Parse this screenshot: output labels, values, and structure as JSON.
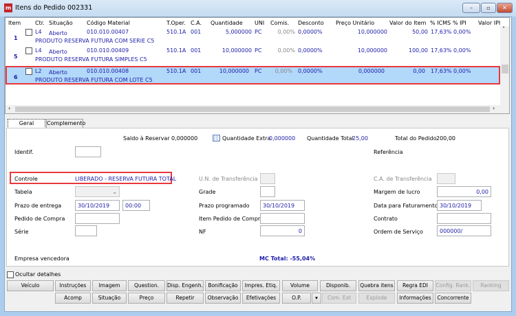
{
  "window": {
    "title": "Itens do Pedido 002331",
    "logo_text": "m",
    "min": "–",
    "max": "▫",
    "close": "✕"
  },
  "grid": {
    "columns": [
      "Item",
      "Ctr.",
      "Situação",
      "Código Material",
      "T.Oper.",
      "C.A.",
      "Quantidade",
      "UNI",
      "Comis.",
      "Desconto",
      "Preço Unitário",
      "Valor do Item",
      "% ICMS",
      "% IPI",
      "Valor IPI"
    ],
    "rows": [
      {
        "item": "1",
        "ctr": "L4",
        "situacao": "Aberto",
        "codigo": "010.010.00407",
        "toper": "510.1A",
        "ca": "001",
        "quantidade": "5,000000",
        "uni": "PC",
        "comis": "0,00%",
        "desconto": "0,0000%",
        "preco": "10,000000",
        "valor": "50,00",
        "icms": "17,63%",
        "ipi": "0,00%",
        "valor_ipi": "",
        "descricao": "PRODUTO RESERVA FUTURA COM SERIE C5",
        "selected": false
      },
      {
        "item": "5",
        "ctr": "L4",
        "situacao": "Aberto",
        "codigo": "010.010.00409",
        "toper": "510.1A",
        "ca": "001",
        "quantidade": "10,000000",
        "uni": "PC",
        "comis": "0,00%",
        "desconto": "0,0000%",
        "preco": "10,000000",
        "valor": "100,00",
        "icms": "17,63%",
        "ipi": "0,00%",
        "valor_ipi": "",
        "descricao": "PRODUTO RESERVA FUTURA SIMPLES C5",
        "selected": false
      },
      {
        "item": "6",
        "ctr": "L2",
        "situacao": "Aberto",
        "codigo": "010.010.00408",
        "toper": "510.1A",
        "ca": "001",
        "quantidade": "10,000000",
        "uni": "PC",
        "comis": "0,00%",
        "desconto": "0,0000%",
        "preco": "0,000000",
        "valor": "0,00",
        "icms": "17,63%",
        "ipi": "0,00%",
        "valor_ipi": "",
        "descricao": "PRODUTO RESERVA FUTURA  COM LOTE C5",
        "selected": true
      }
    ],
    "selection_color": "#b2d8fa",
    "highlight_color": "#e8383c"
  },
  "tabs": [
    "Geral",
    "Complemento"
  ],
  "summary": {
    "saldo_label": "Saldo à Reservar",
    "saldo": "0,000000",
    "qtd_extra_label": "Quantidade Extra",
    "qtd_extra": "0,000000",
    "qtd_total_label": "Quantidade Total",
    "qtd_total": "25,00",
    "total_pedido_label": "Total do Pedido",
    "total_pedido": "200,00"
  },
  "form": {
    "identif": "Identif.",
    "referencia": "Referência",
    "controle_label": "Controle",
    "controle": "LIBERADO - RESERVA FUTURA TOTAL",
    "un_transf": "U.N. de Transferência",
    "ca_transf": "C.A. de Transferência",
    "tabela": "Tabela",
    "grade": "Grade",
    "margem": "Margem de lucro",
    "margem_val": "0,00",
    "prazo_entrega": "Prazo de entrega",
    "prazo_entrega_data": "30/10/2019",
    "prazo_entrega_hora": "00:00",
    "prazo_prog": "Prazo programado",
    "prazo_prog_val": "30/10/2019",
    "data_fat": "Data para Faturamento",
    "data_fat_val": "30/10/2019",
    "pedido_compra": "Pedido de Compra",
    "item_pedido_compra": "Item Pedido de Compra",
    "contrato": "Contrato",
    "serie": "Série",
    "nf": "NF",
    "nf_val": "0",
    "ordem_servico": "Ordem de Serviço",
    "ordem_servico_val": "000000/",
    "empresa": "Empresa vencedora",
    "mc_total": "MC Total: -55,04%"
  },
  "ocultar": "Ocultar detalhes",
  "buttons_row1": [
    {
      "label": "Veículo",
      "enabled": true
    },
    {
      "label": "Instruções",
      "enabled": true
    },
    {
      "label": "Imagem",
      "enabled": true
    },
    {
      "label": "Question.",
      "enabled": true
    },
    {
      "label": "Disp. Engenh.",
      "enabled": true
    },
    {
      "label": "Bonificação",
      "enabled": true
    },
    {
      "label": "Impres. Etiq.",
      "enabled": true
    },
    {
      "label": "Volume",
      "enabled": true
    },
    {
      "label": "Disponib.",
      "enabled": true
    },
    {
      "label": "Quebra itens",
      "enabled": true
    },
    {
      "label": "Regra EDI",
      "enabled": true
    },
    {
      "label": "Config. Rank.",
      "enabled": false
    },
    {
      "label": "Ranking",
      "enabled": false
    }
  ],
  "buttons_row2": [
    {
      "label": "Acomp",
      "enabled": true
    },
    {
      "label": "Situação",
      "enabled": true
    },
    {
      "label": "Preço",
      "enabled": true
    },
    {
      "label": "Repetir",
      "enabled": true
    },
    {
      "label": "Observação",
      "enabled": true
    },
    {
      "label": "Efetivações",
      "enabled": true
    },
    {
      "label": "O.P.",
      "enabled": true
    },
    {
      "label": "▾",
      "enabled": true
    },
    {
      "label": "Com. Ext",
      "enabled": false
    },
    {
      "label": "Explode",
      "enabled": false
    },
    {
      "label": "Informações",
      "enabled": true
    },
    {
      "label": "Concorrente",
      "enabled": true
    }
  ]
}
